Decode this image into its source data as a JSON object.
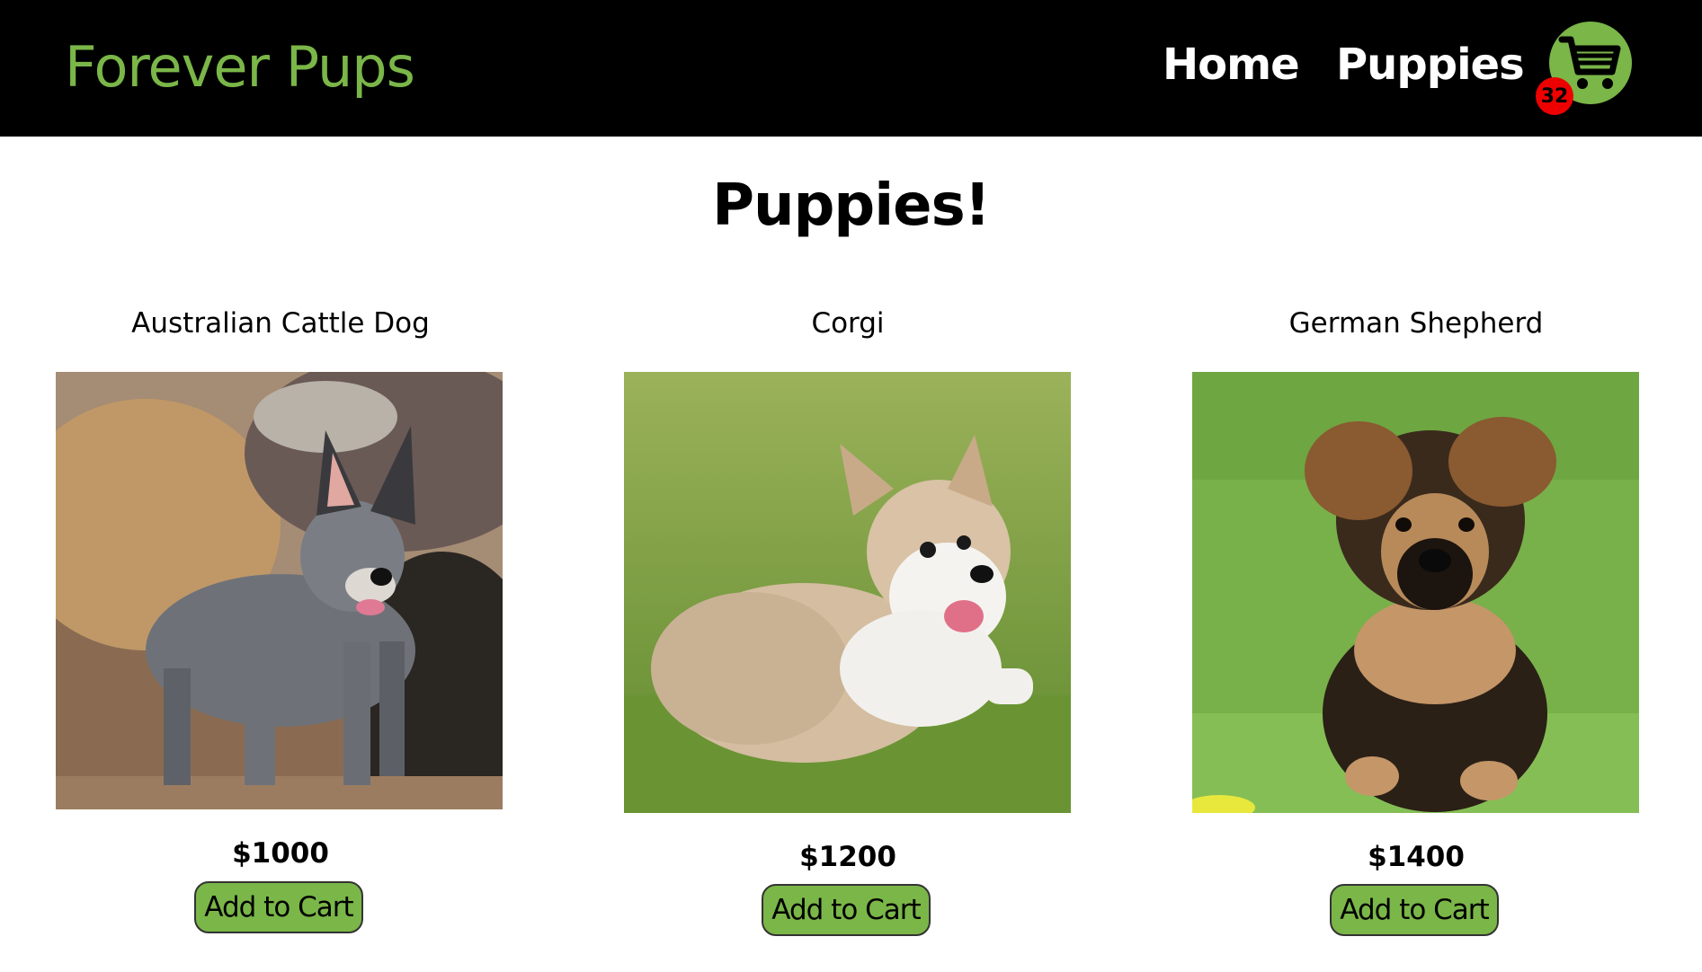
{
  "navbar": {
    "brand": "Forever Pups",
    "links": [
      {
        "label": "Home"
      },
      {
        "label": "Puppies"
      }
    ],
    "cart": {
      "icon": "cart-icon",
      "count": "32"
    },
    "colors": {
      "background": "#000000",
      "brand": "#7ab648",
      "badge": "#ee0000"
    }
  },
  "main": {
    "title": "Puppies!",
    "products": [
      {
        "name": "Australian Cattle Dog",
        "price": "$1000",
        "button_label": "Add to Cart"
      },
      {
        "name": "Corgi",
        "price": "$1200",
        "button_label": "Add to Cart"
      },
      {
        "name": "German Shepherd",
        "price": "$1400",
        "button_label": "Add to Cart"
      }
    ]
  }
}
